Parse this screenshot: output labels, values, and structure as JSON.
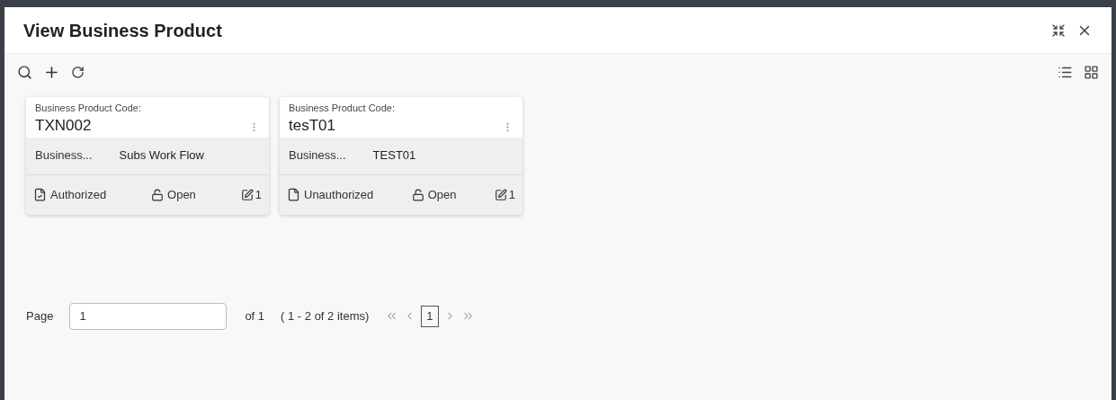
{
  "window": {
    "title": "View Business Product"
  },
  "cards": [
    {
      "code_label": "Business Product Code:",
      "code": "TXN002",
      "field_label": "Business...",
      "field_value": "Subs Work Flow",
      "status": "Authorized",
      "authorized": true,
      "lock": "Open",
      "edits": "1"
    },
    {
      "code_label": "Business Product Code:",
      "code": "tesT01",
      "field_label": "Business...",
      "field_value": "TEST01",
      "status": "Unauthorized",
      "authorized": false,
      "lock": "Open",
      "edits": "1"
    }
  ],
  "pagination": {
    "label": "Page",
    "value": "1",
    "of": "of 1",
    "items": "( 1 - 2 of 2 items)",
    "pages": [
      {
        "label": "1",
        "selected": true
      }
    ]
  }
}
